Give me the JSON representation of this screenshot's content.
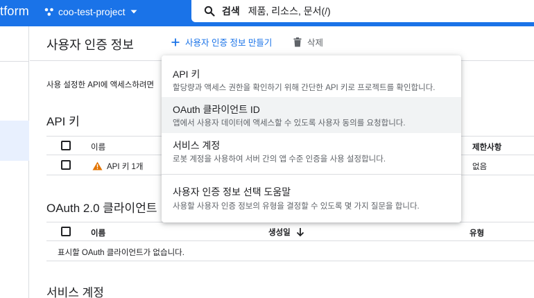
{
  "topbar": {
    "brand_fragment": "tform",
    "project_name": "coo-test-project",
    "search_label": "검색",
    "search_placeholder": "제품, 리소스, 문서(/)",
    "color": "#1a73e8"
  },
  "header": {
    "title": "사용자 인증 정보",
    "create_label": "사용자 인증 정보 만들기",
    "delete_label": "삭제"
  },
  "intro_text": "사용 설정한 API에 액세스하려면",
  "api_keys": {
    "title": "API 키",
    "columns": {
      "name": "이름",
      "restrictions": "제한사항"
    },
    "rows": [
      {
        "name": "API 키 1개",
        "restrictions": "없음",
        "warning_icon": "warning-icon"
      }
    ]
  },
  "oauth": {
    "title": "OAuth 2.0 클라이언트",
    "columns": {
      "name": "이름",
      "created": "생성일",
      "type": "유형"
    },
    "empty_text": "표시할 OAuth 클라이언트가 없습니다."
  },
  "service_accounts": {
    "title": "서비스 계정"
  },
  "create_menu": {
    "items": [
      {
        "title": "API 키",
        "description": "할당량과 액세스 권한을 확인하기 위해 간단한 API 키로 프로젝트를 확인합니다."
      },
      {
        "title": "OAuth 클라이언트 ID",
        "description": "앱에서 사용자 데이터에 액세스할 수 있도록 사용자 동의를 요청합니다."
      },
      {
        "title": "서비스 계정",
        "description": "로봇 계정을 사용하여 서버 간의 앱 수준 인증을 사용 설정합니다."
      },
      {
        "title": "사용자 인증 정보 선택 도움말",
        "description": "사용할 사용자 인증 정보의 유형을 결정할 수 있도록 몇 가지 질문을 합니다."
      }
    ]
  }
}
